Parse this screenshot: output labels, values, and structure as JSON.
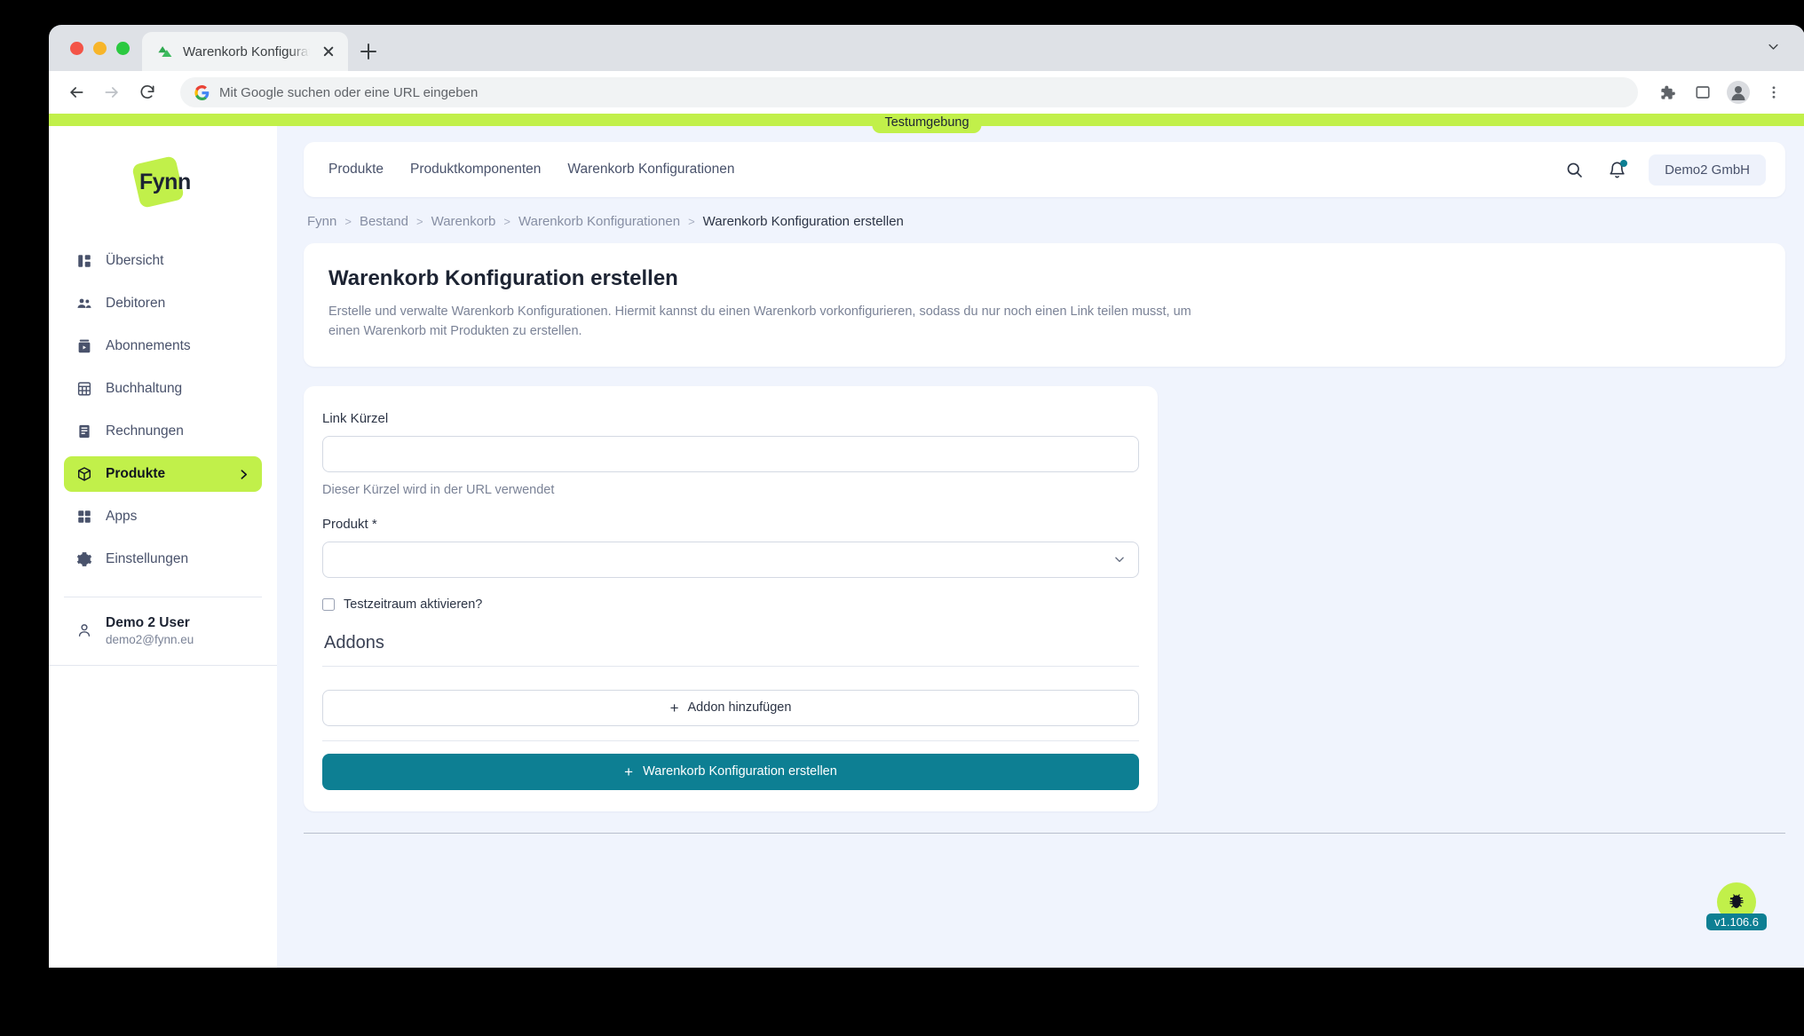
{
  "browser": {
    "tab": {
      "title": "Warenkorb Konfiguration erstel",
      "favicon_name": "fynn-favicon"
    },
    "new_tab_label": "+",
    "omnibox": {
      "placeholder": "Mit Google suchen oder eine URL eingeben",
      "value": ""
    },
    "toolbar_icons": [
      "back-icon",
      "forward-icon",
      "reload-icon",
      "extensions-icon",
      "sidepanel-icon",
      "profile-avatar-icon",
      "chrome-menu-icon"
    ]
  },
  "environment_banner": {
    "label": "Testumgebung"
  },
  "sidebar": {
    "logo_text": "Fynn",
    "items": [
      {
        "label": "Übersicht",
        "icon": "dashboard-icon",
        "active": false
      },
      {
        "label": "Debitoren",
        "icon": "users-icon",
        "active": false
      },
      {
        "label": "Abonnements",
        "icon": "subscription-icon",
        "active": false
      },
      {
        "label": "Buchhaltung",
        "icon": "calculator-icon",
        "active": false
      },
      {
        "label": "Rechnungen",
        "icon": "invoice-icon",
        "active": false
      },
      {
        "label": "Produkte",
        "icon": "box-icon",
        "active": true
      },
      {
        "label": "Apps",
        "icon": "apps-icon",
        "active": false
      },
      {
        "label": "Einstellungen",
        "icon": "gear-icon",
        "active": false
      }
    ],
    "user": {
      "name": "Demo 2 User",
      "email": "demo2@fynn.eu",
      "icon": "person-icon"
    }
  },
  "topbar": {
    "nav": [
      {
        "label": "Produkte"
      },
      {
        "label": "Produktkomponenten"
      },
      {
        "label": "Warenkorb Konfigurationen"
      }
    ],
    "search_icon": "search-icon",
    "notification_icon": "bell-icon",
    "company": "Demo2 GmbH"
  },
  "breadcrumb": {
    "separator": ">",
    "items": [
      {
        "label": "Fynn"
      },
      {
        "label": "Bestand"
      },
      {
        "label": "Warenkorb"
      },
      {
        "label": "Warenkorb Konfigurationen"
      },
      {
        "label": "Warenkorb Konfiguration erstellen"
      }
    ]
  },
  "hero": {
    "title": "Warenkorb Konfiguration erstellen",
    "subtitle": "Erstelle und verwalte Warenkorb Konfigurationen. Hiermit kannst du einen Warenkorb vorkonfigurieren, sodass du nur noch einen Link teilen musst, um einen Warenkorb mit Produkten zu erstellen."
  },
  "form": {
    "link_kuerzel": {
      "label": "Link Kürzel",
      "value": "",
      "placeholder": "",
      "hint": "Dieser Kürzel wird in der URL verwendet"
    },
    "produkt": {
      "label": "Produkt *",
      "value": "",
      "placeholder": "",
      "chevron": "chevron-down-icon"
    },
    "testzeitraum": {
      "label": "Testzeitraum aktivieren?",
      "checked": false
    },
    "addons_section": {
      "title": "Addons",
      "add_label": "Addon hinzufügen",
      "add_glyph": "+"
    },
    "submit": {
      "label": "Warenkorb Konfiguration erstellen",
      "glyph": "+"
    }
  },
  "debug_fab": {
    "icon": "bug-icon",
    "version": "v1.106.6"
  },
  "colors": {
    "brand_green": "#c1f04a",
    "accent_teal": "#0d7f93",
    "page_bg": "#f0f4fd",
    "text_dark": "#1d2433",
    "text_muted": "#7b8397"
  }
}
